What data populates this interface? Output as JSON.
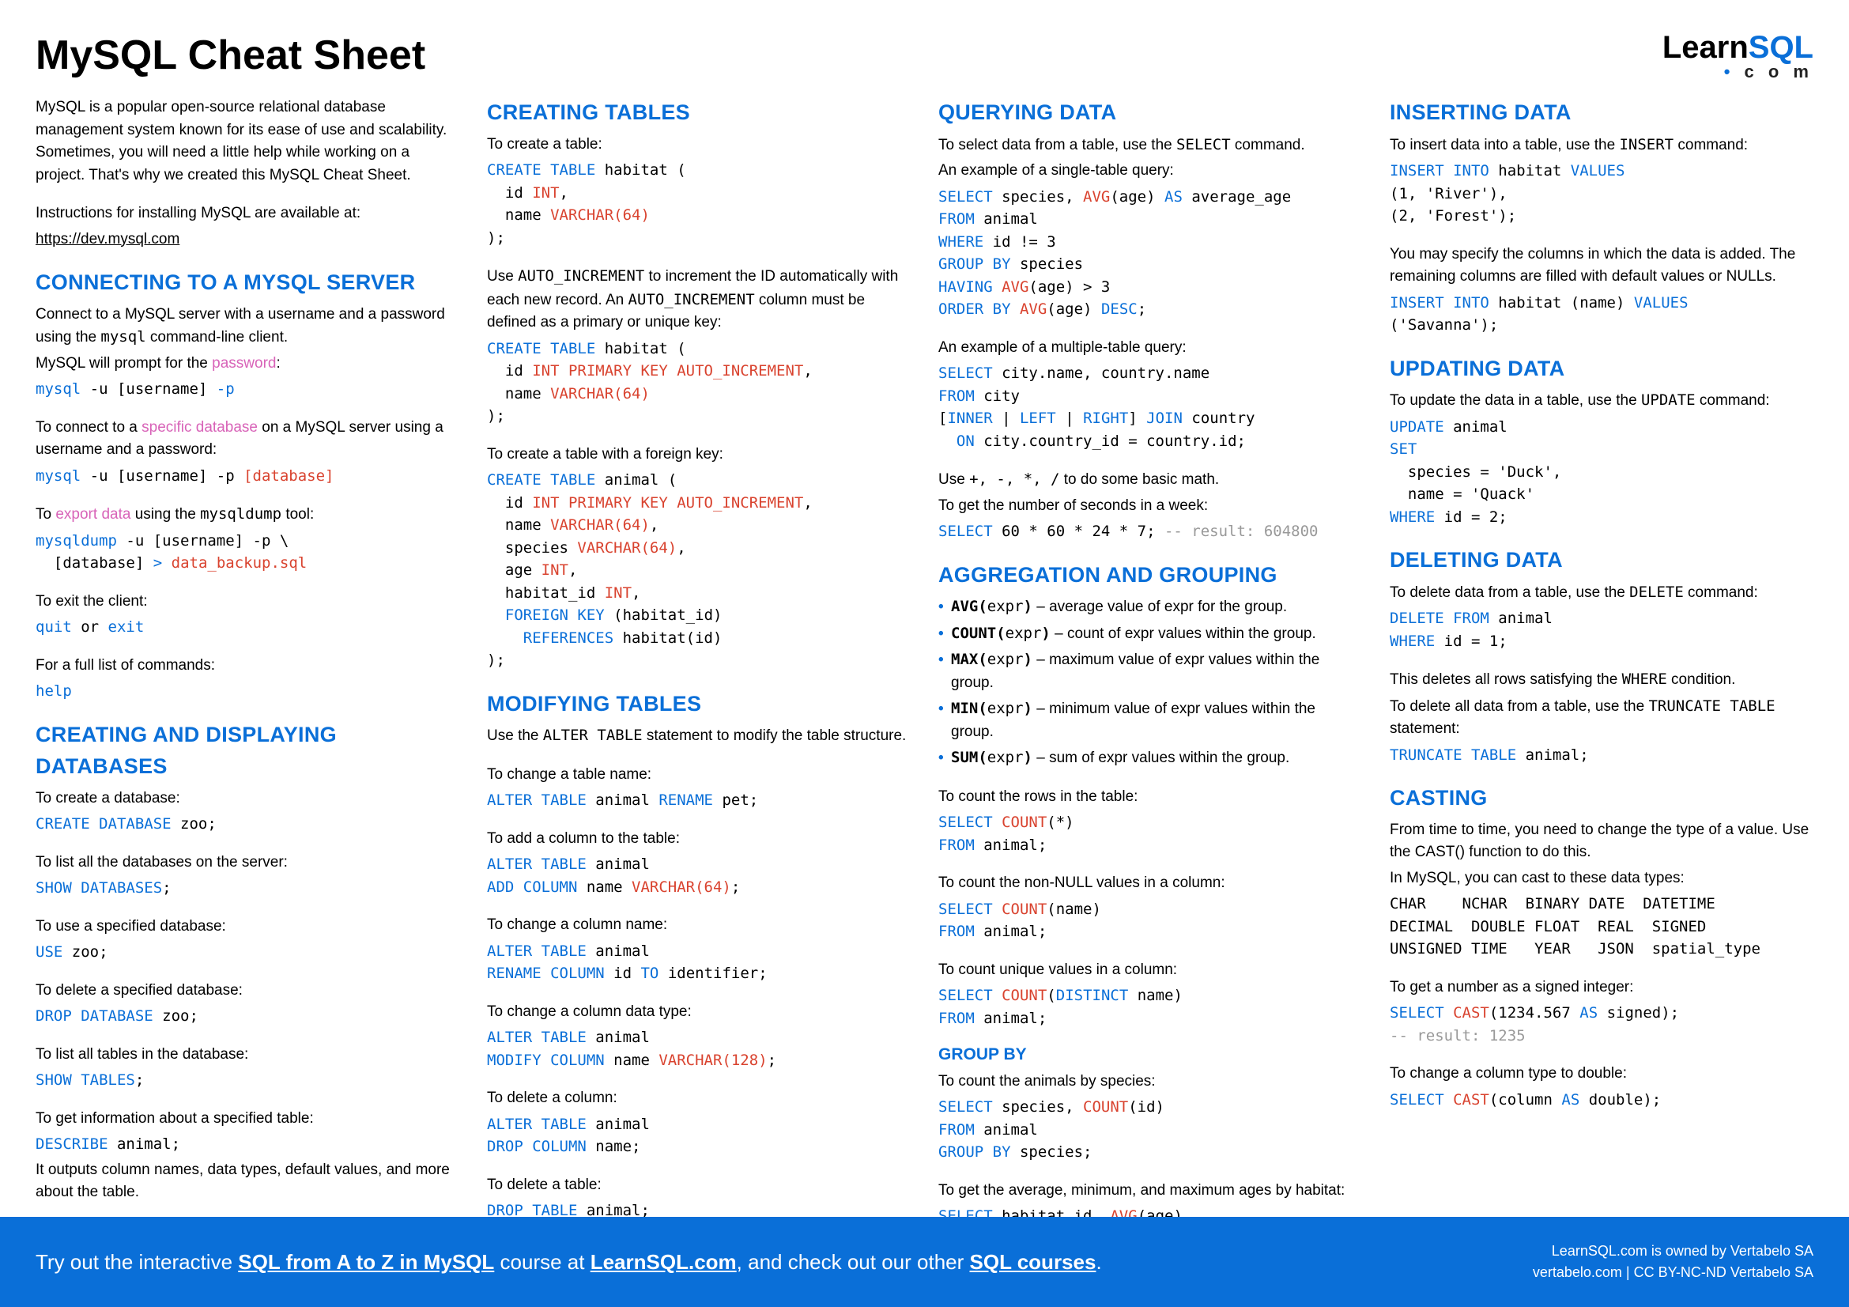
{
  "title": "MySQL Cheat Sheet",
  "logo": {
    "learn": "Learn",
    "sql": "SQL",
    "dot": "•",
    "com": "c o m"
  },
  "intro": {
    "p1": "MySQL is a popular open-source relational database management system known for its ease of use and scalability. Sometimes, you will need a little help while working on a project. That's why we created this MySQL Cheat Sheet.",
    "p2": "Instructions for installing MySQL are available at:",
    "link": "https://dev.mysql.com"
  },
  "connecting": {
    "h": "CONNECTING TO A MYSQL SERVER",
    "p1a": "Connect to a MySQL server with a username and a password using the ",
    "p1b": " command-line client.",
    "p2a": "MySQL will prompt for the ",
    "p2b": ":",
    "p3a": "To connect to a ",
    "p3b": " on a MySQL server using a username and a password:",
    "p4a": "To ",
    "p4b": " using the ",
    "p4c": " tool:",
    "p5": "To exit the client:",
    "p6": "For a full list of commands:",
    "mysql": "mysql",
    "password": "password",
    "specific_db": "specific database",
    "export_data": "export data",
    "mysqldump": "mysqldump"
  },
  "databases": {
    "h": "CREATING AND DISPLAYING DATABASES",
    "p1": "To create a database:",
    "p2": "To list all the databases on the server:",
    "p3": "To use a specified database:",
    "p4": "To delete a specified database:",
    "p5": "To list all tables in the database:",
    "p6": "To get information about a specified table:",
    "p7": "It outputs column names, data types, default values, and more about the table."
  },
  "creating_tables": {
    "h": "CREATING TABLES",
    "p1": "To create a table:",
    "p2a": "Use ",
    "p2b": " to increment the ID automatically with each new record. An ",
    "p2c": " column must be defined as a primary or unique key:",
    "auto_inc": "AUTO_INCREMENT",
    "p3": "To create a table with a foreign key:"
  },
  "modifying": {
    "h": "MODIFYING TABLES",
    "p1a": "Use the ",
    "p1b": " statement to modify the table structure.",
    "alter": "ALTER TABLE",
    "p2": "To change a table name:",
    "p3": "To add a column to the table:",
    "p4": "To change a column name:",
    "p5": "To change a column data type:",
    "p6": "To delete a column:",
    "p7": "To delete a table:"
  },
  "querying": {
    "h": "QUERYING DATA",
    "p1a": "To select data from a table, use the ",
    "p1b": " command.",
    "select": "SELECT",
    "p2": "An example of a single-table query:",
    "p3": "An example of a multiple-table query:",
    "p4a": "Use ",
    "p4b": " to do some basic math.",
    "ops": "+, -, *, /",
    "p5": "To get the number of seconds in a week:"
  },
  "aggregation": {
    "h": "AGGREGATION AND GROUPING",
    "items": [
      {
        "fn": "AVG(",
        "arg": "expr",
        "close": ")",
        "desc": " – average value of expr for the group."
      },
      {
        "fn": "COUNT(",
        "arg": "expr",
        "close": ")",
        "desc": " – count of expr values within the group."
      },
      {
        "fn": "MAX(",
        "arg": "expr",
        "close": ")",
        "desc": " – maximum value of expr values within the group."
      },
      {
        "fn": "MIN(",
        "arg": "expr",
        "close": ")",
        "desc": " – minimum value of expr values within the group."
      },
      {
        "fn": "SUM(",
        "arg": "expr",
        "close": ")",
        "desc": " – sum of expr values within the group."
      }
    ],
    "p1": "To count the rows in the table:",
    "p2": "To count the non-NULL values in a column:",
    "p3": "To count unique values in a column:"
  },
  "groupby": {
    "h": "GROUP BY",
    "p1": "To count the animals by species:",
    "p2": "To get the average, minimum, and maximum ages by habitat:"
  },
  "inserting": {
    "h": "INSERTING DATA",
    "p1a": "To insert data into a table, use the ",
    "p1b": " command:",
    "insert": "INSERT",
    "p2": "You may specify the columns in which the data is added. The remaining columns are filled with default values or NULLs."
  },
  "updating": {
    "h": "UPDATING DATA",
    "p1a": "To update the data in a table, use the ",
    "p1b": " command:",
    "update": "UPDATE"
  },
  "deleting": {
    "h": "DELETING DATA",
    "p1a": "To delete data from a table, use the ",
    "p1b": " command:",
    "delete": "DELETE",
    "p2a": "This deletes all rows satisfying the ",
    "p2b": " condition.",
    "where": "WHERE",
    "p3a": "To delete all data from a table, use the ",
    "p3b": " statement:",
    "truncate": "TRUNCATE TABLE"
  },
  "casting": {
    "h": "CASTING",
    "p1": "From time to time, you need to change the type of a value. Use the CAST() function to do this.",
    "p2": "In MySQL, you can cast to these data types:",
    "types": "CHAR    NCHAR  BINARY DATE  DATETIME\nDECIMAL  DOUBLE FLOAT  REAL  SIGNED\nUNSIGNED TIME   YEAR   JSON  spatial_type",
    "p3": "To get a number as a signed integer:",
    "p4": "To change a column type to double:"
  },
  "footer": {
    "text1": "Try out the interactive ",
    "link1": "SQL from A to Z in MySQL",
    "text2": " course at ",
    "link2": "LearnSQL.com",
    "text3": ", and check out our other ",
    "link3": "SQL courses",
    "text4": ".",
    "right1": "LearnSQL.com is owned by Vertabelo SA",
    "right2": "vertabelo.com | CC BY-NC-ND Vertabelo SA"
  }
}
